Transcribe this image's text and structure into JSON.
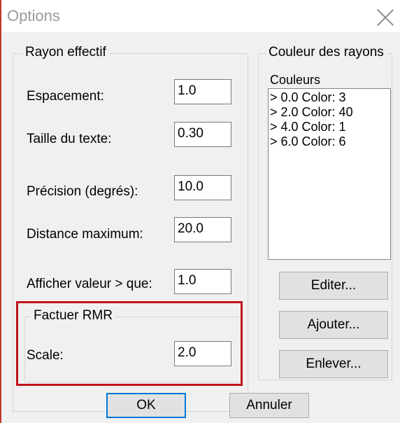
{
  "window": {
    "title": "Options"
  },
  "rayon_effectif": {
    "legend": "Rayon effectif",
    "fields": [
      {
        "label": "Espacement:",
        "value": "1.0"
      },
      {
        "label": "Taille du texte:",
        "value": "0.30"
      },
      {
        "label": "Précision (degrés):",
        "value": "10.0"
      },
      {
        "label": "Distance maximum:",
        "value": "20.0"
      },
      {
        "label": "Afficher valeur > que:",
        "value": "1.0"
      }
    ]
  },
  "facteur_rmr": {
    "legend": "Factuer RMR",
    "scale_label": "Scale:",
    "scale_value": "2.0"
  },
  "couleur_rayons": {
    "legend": "Couleur des rayons",
    "list_label": "Couleurs",
    "items": [
      "> 0.0 Color: 3",
      "> 2.0 Color: 40",
      "> 4.0 Color: 1",
      "> 6.0 Color: 6"
    ],
    "buttons": {
      "edit": "Editer...",
      "add": "Ajouter...",
      "remove": "Enlever..."
    }
  },
  "footer": {
    "ok": "OK",
    "cancel": "Annuler"
  },
  "colors": {
    "highlight": "#c0131b",
    "default_button_border": "#0078d7"
  }
}
